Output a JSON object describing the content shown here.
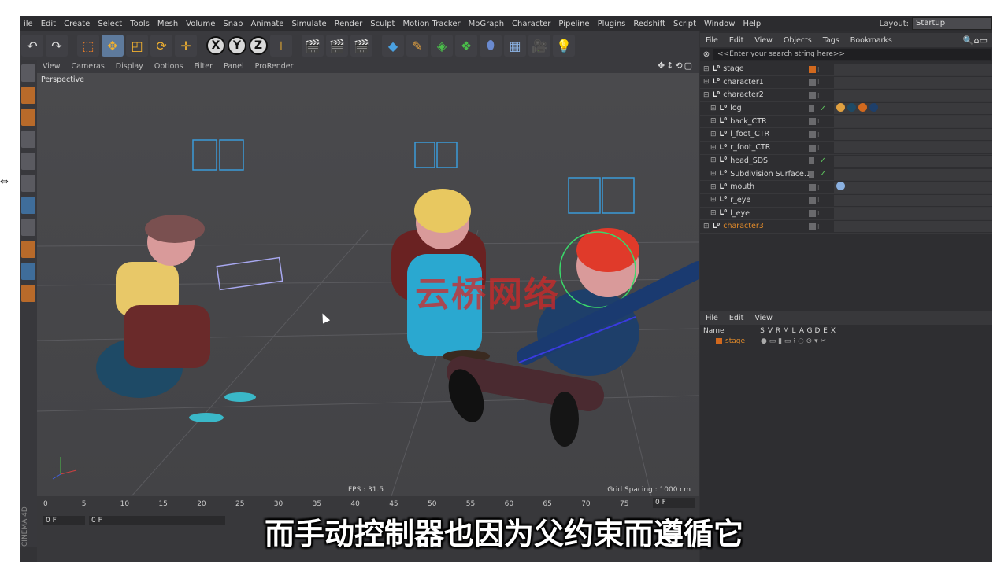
{
  "menubar": {
    "items": [
      "ile",
      "Edit",
      "Create",
      "Select",
      "Tools",
      "Mesh",
      "Volume",
      "Snap",
      "Animate",
      "Simulate",
      "Render",
      "Sculpt",
      "Motion Tracker",
      "MoGraph",
      "Character",
      "Pipeline",
      "Plugins",
      "Redshift",
      "Script",
      "Window",
      "Help"
    ],
    "layout_label": "Layout:",
    "layout_value": "Startup"
  },
  "toolbar": {
    "axis_x": "X",
    "axis_y": "Y",
    "axis_z": "Z"
  },
  "viewport": {
    "menu": [
      "View",
      "Cameras",
      "Display",
      "Options",
      "Filter",
      "Panel",
      "ProRender"
    ],
    "camera_label": "Perspective",
    "fps": "FPS : 31.5",
    "grid_spacing": "Grid Spacing : 1000 cm",
    "watermark": "云桥网络"
  },
  "timeline": {
    "ticks": [
      "0",
      "5",
      "10",
      "15",
      "20",
      "25",
      "30",
      "35",
      "40",
      "45",
      "50",
      "55",
      "60",
      "65",
      "70",
      "75"
    ],
    "current_frame": "0 F",
    "start_frame": "0 F",
    "frame_field": "0 F",
    "brand": "CINEMA 4D"
  },
  "object_manager": {
    "menu": [
      "File",
      "Edit",
      "View",
      "Objects",
      "Tags",
      "Bookmarks"
    ],
    "search_placeholder": "<<Enter your search string here>>",
    "objects": [
      {
        "name": "stage",
        "indent": 0,
        "orange_flag": true,
        "check": false
      },
      {
        "name": "character1",
        "indent": 0,
        "orange_flag": false,
        "check": false
      },
      {
        "name": "character2",
        "indent": 0,
        "orange_flag": false,
        "check": false,
        "expanded": true
      },
      {
        "name": "log",
        "indent": 1,
        "orange_flag": false,
        "check": true
      },
      {
        "name": "back_CTR",
        "indent": 1,
        "orange_flag": false,
        "check": false
      },
      {
        "name": "l_foot_CTR",
        "indent": 1,
        "orange_flag": false,
        "check": false
      },
      {
        "name": "r_foot_CTR",
        "indent": 1,
        "orange_flag": false,
        "check": false
      },
      {
        "name": "head_SDS",
        "indent": 1,
        "orange_flag": false,
        "check": true
      },
      {
        "name": "Subdivision Surface.1",
        "indent": 1,
        "orange_flag": false,
        "check": true
      },
      {
        "name": "mouth",
        "indent": 1,
        "orange_flag": false,
        "check": false
      },
      {
        "name": "r_eye",
        "indent": 1,
        "orange_flag": false,
        "check": false
      },
      {
        "name": "l_eye",
        "indent": 1,
        "orange_flag": false,
        "check": false
      },
      {
        "name": "character3",
        "indent": 0,
        "orange_flag": false,
        "check": false,
        "orange_text": true
      }
    ]
  },
  "layer_manager": {
    "menu": [
      "File",
      "Edit",
      "View"
    ],
    "columns": [
      "Name",
      "S",
      "V",
      "R",
      "M",
      "L",
      "A",
      "G",
      "D",
      "E",
      "X"
    ],
    "layer": "stage"
  },
  "subtitle": "而手动控制器也因为父约束而遵循它",
  "colors": {
    "accent_orange": "#e08a2a",
    "panel_bg": "#333336",
    "viewport_bg": "#4a4a4d"
  }
}
